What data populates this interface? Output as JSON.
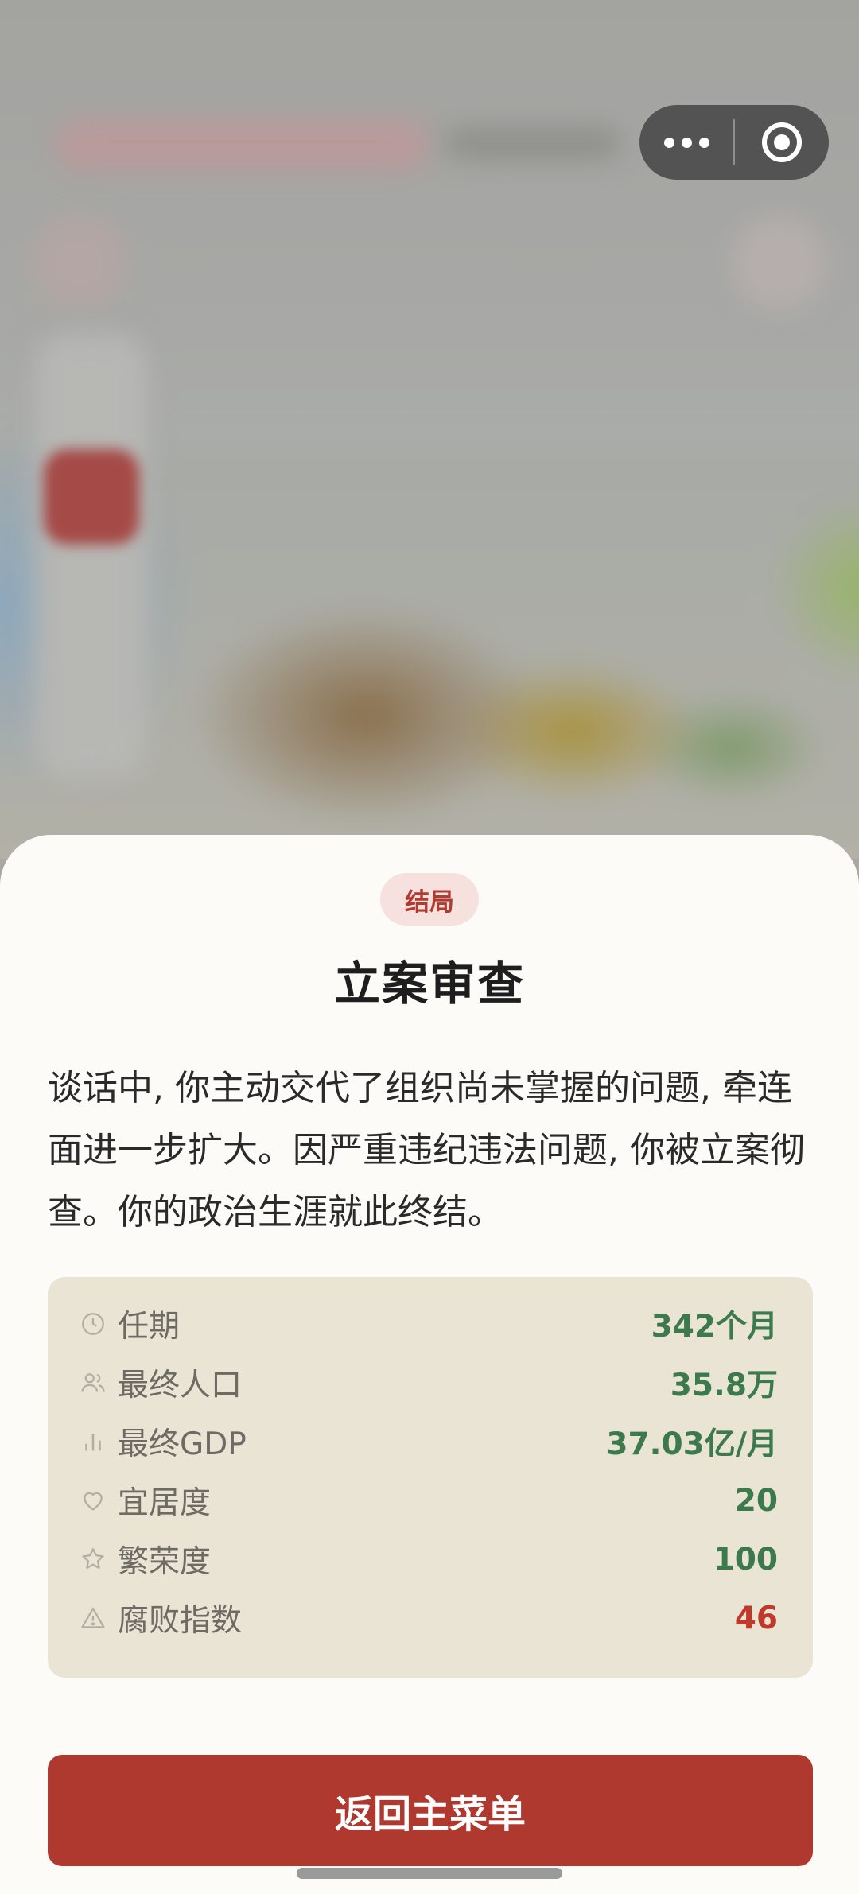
{
  "capsule": {
    "more_icon": "more-dots-icon",
    "close_icon": "close-ring-icon"
  },
  "sheet": {
    "badge": "结局",
    "title": "立案审查",
    "description": "谈话中, 你主动交代了组织尚未掌握的问题, 牵连面进一步扩大。因严重违纪违法问题, 你被立案彻查。你的政治生涯就此终结。",
    "stats": [
      {
        "icon": "clock-icon",
        "label": "任期",
        "value": "342个月",
        "color": "#3c7a4d"
      },
      {
        "icon": "people-icon",
        "label": "最终人口",
        "value": "35.8万",
        "color": "#3c7a4d"
      },
      {
        "icon": "bar-chart-icon",
        "label": "最终GDP",
        "value": "37.03亿/月",
        "color": "#3c7a4d"
      },
      {
        "icon": "heart-icon",
        "label": "宜居度",
        "value": "20",
        "color": "#3c7a4d"
      },
      {
        "icon": "star-icon",
        "label": "繁荣度",
        "value": "100",
        "color": "#3c7a4d"
      },
      {
        "icon": "warning-icon",
        "label": "腐败指数",
        "value": "46",
        "color": "#c0392b"
      }
    ],
    "button_label": "返回主菜单"
  },
  "colors": {
    "accent_red": "#b0392f",
    "value_green": "#3c7a4d",
    "sheet_bg": "#fcfbf7",
    "stats_bg": "#eae4d5"
  }
}
